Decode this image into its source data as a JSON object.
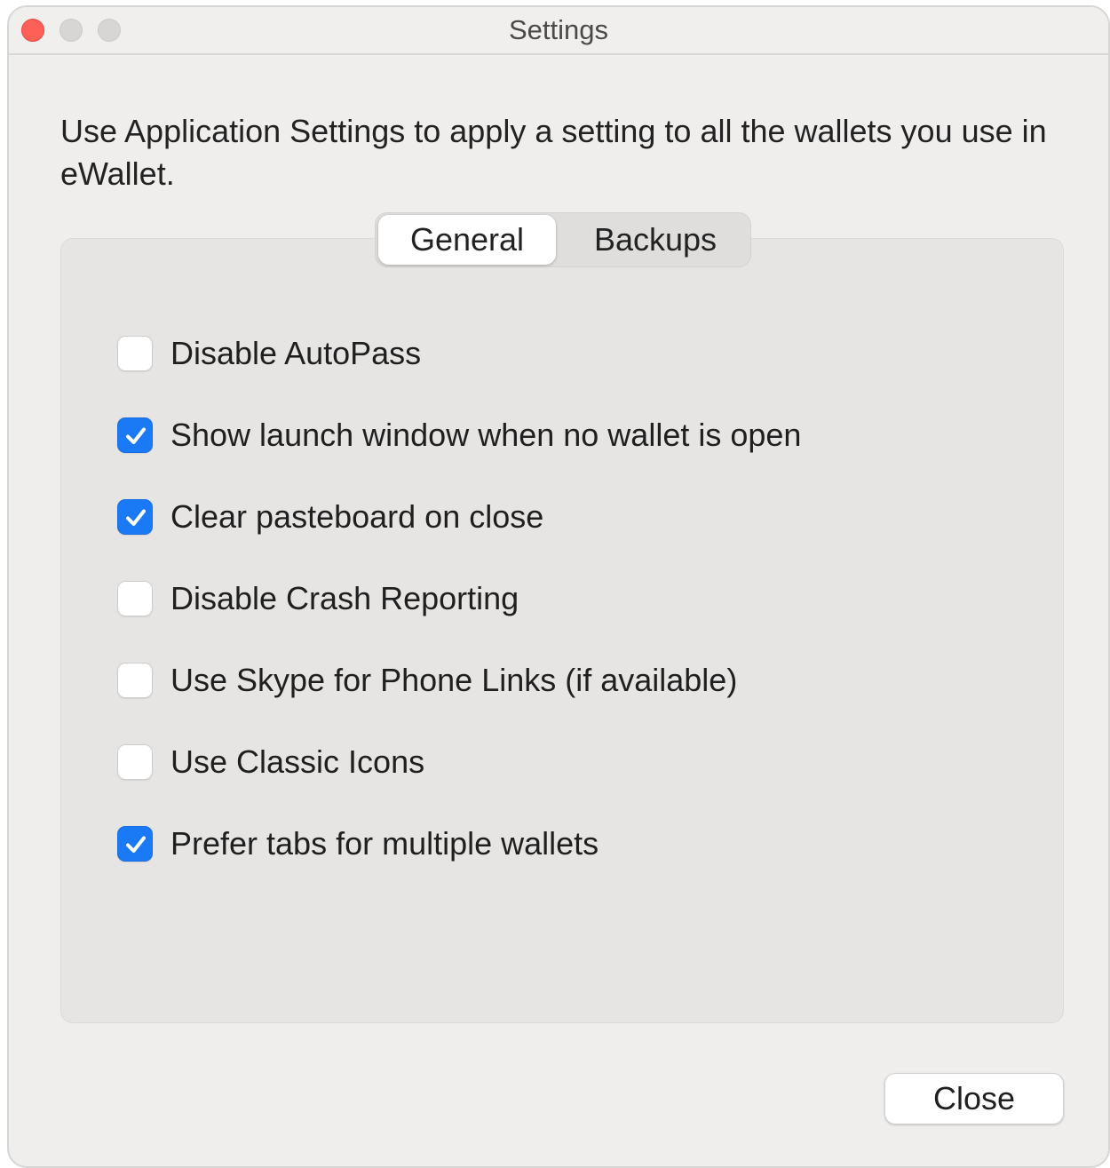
{
  "window": {
    "title": "Settings"
  },
  "description": "Use Application Settings to apply a setting to all the wallets you use in eWallet.",
  "tabs": [
    {
      "label": "General",
      "selected": true
    },
    {
      "label": "Backups",
      "selected": false
    }
  ],
  "options": [
    {
      "label": "Disable AutoPass",
      "checked": false
    },
    {
      "label": "Show launch window when no wallet is open",
      "checked": true
    },
    {
      "label": "Clear pasteboard on close",
      "checked": true
    },
    {
      "label": "Disable Crash Reporting",
      "checked": false
    },
    {
      "label": "Use Skype for Phone Links (if available)",
      "checked": false
    },
    {
      "label": "Use Classic Icons",
      "checked": false
    },
    {
      "label": "Prefer tabs for multiple wallets",
      "checked": true
    }
  ],
  "footer": {
    "close_label": "Close"
  },
  "colors": {
    "accent": "#1a7af6",
    "close_light": "#fe5f57"
  }
}
